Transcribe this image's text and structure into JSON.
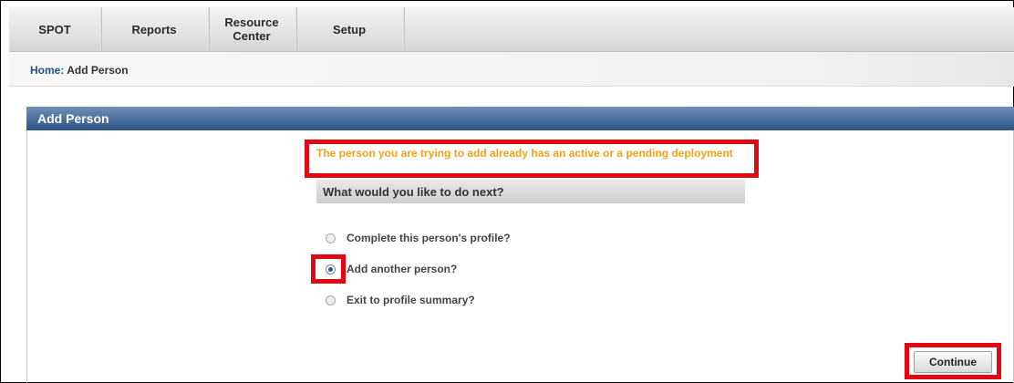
{
  "nav": {
    "items": [
      {
        "label": "SPOT"
      },
      {
        "label": "Reports"
      },
      {
        "label_line1": "Resource",
        "label_line2": "Center"
      },
      {
        "label": "Setup"
      }
    ]
  },
  "breadcrumb": {
    "home": "Home",
    "separator": ":",
    "current": " Add Person"
  },
  "panel": {
    "title": "Add Person"
  },
  "warning": {
    "text": "The person you are trying to add already has an active or a pending deployment"
  },
  "question": {
    "title": "What would you like to do next?"
  },
  "options": [
    {
      "label": "Complete this person's profile?",
      "selected": false
    },
    {
      "label": "Add another person?",
      "selected": true
    },
    {
      "label": "Exit to profile summary?",
      "selected": false
    }
  ],
  "continue_button": {
    "label": "Continue"
  },
  "colors": {
    "highlight": "#e30613",
    "warning": "#f5a01a",
    "panel_header": "#2e5486",
    "link": "#1f4e8f"
  }
}
